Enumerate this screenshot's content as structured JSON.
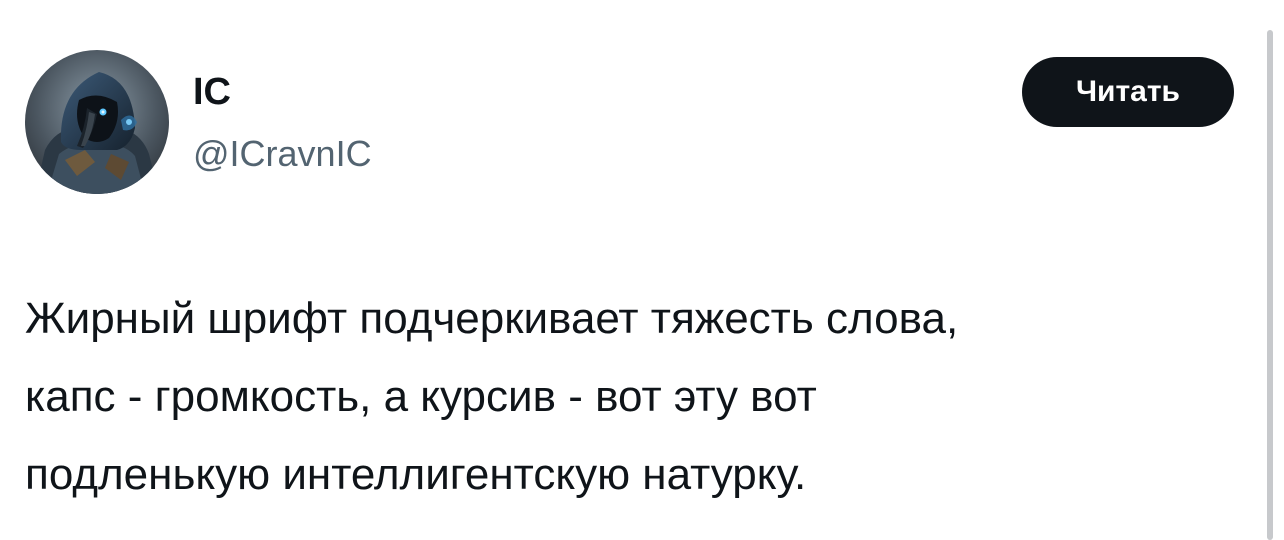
{
  "author": {
    "display_name": "IC",
    "handle": "@ICravnIC",
    "avatar_icon": "hooded-raven-knight-avatar"
  },
  "follow_button": {
    "label": "Читать"
  },
  "tweet": {
    "lines": [
      "Жирный шрифт подчеркивает тяжесть слова,",
      "капс - громкость, а курсив - вот эту вот",
      "подленькую интеллигентскую натурку."
    ]
  },
  "colors": {
    "text_primary": "#0f1419",
    "text_secondary": "#536471",
    "button_bg": "#0f1419",
    "button_text": "#ffffff",
    "background": "#ffffff"
  }
}
